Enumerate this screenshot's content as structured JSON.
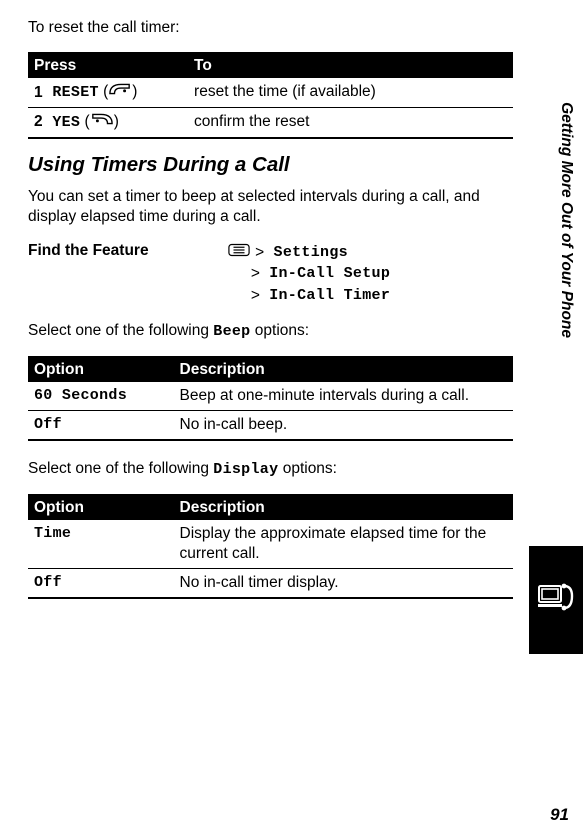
{
  "intro_reset": "To reset the call timer:",
  "t1": {
    "head_press": "Press",
    "head_to": "To",
    "r1_num": "1",
    "r1_key": "RESET",
    "r1_desc": "reset the time (if available)",
    "r2_num": "2",
    "r2_key": "YES",
    "r2_desc": "confirm the reset"
  },
  "section_heading": "Using Timers During a Call",
  "section_body": "You can set a timer to beep at selected intervals during a call, and display elapsed time during a call.",
  "ftf_label": "Find the Feature",
  "ftf": {
    "p1": "Settings",
    "p2": "In-Call Setup",
    "p3": "In-Call Timer"
  },
  "beep_intro_a": "Select one of the following ",
  "beep_code": "Beep",
  "beep_intro_b": " options:",
  "t2": {
    "head_opt": "Option",
    "head_desc": "Description",
    "r1_opt": "60 Seconds",
    "r1_desc": "Beep at one-minute intervals during a call.",
    "r2_opt": "Off",
    "r2_desc": "No in-call beep."
  },
  "disp_intro_a": "Select one of the following ",
  "disp_code": "Display",
  "disp_intro_b": " options:",
  "t3": {
    "head_opt": "Option",
    "head_desc": "Description",
    "r1_opt": "Time",
    "r1_desc": "Display the approximate elapsed time for the current call.",
    "r2_opt": "Off",
    "r2_desc": "No in-call timer display."
  },
  "side_label": "Getting More Out of Your Phone",
  "page_number": "91"
}
